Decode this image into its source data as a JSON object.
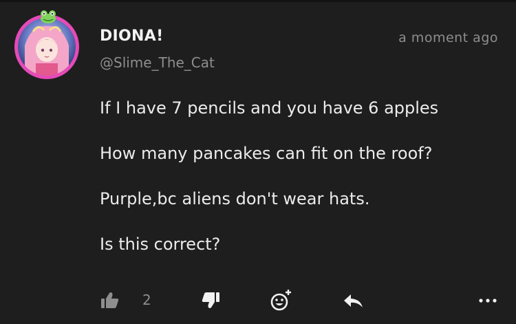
{
  "post": {
    "author_name": "DIONA!",
    "author_handle": "@Slime_The_Cat",
    "timestamp": "a moment ago",
    "lines": [
      "If I have 7 pencils and you have 6 apples",
      "How many pancakes can fit on the roof?",
      "Purple,bc aliens don't wear hats.",
      "Is this correct?"
    ]
  },
  "actions": {
    "like_icon": "thumbs-up-icon",
    "like_count": "2",
    "dislike_icon": "thumbs-down-icon",
    "react_icon": "add-reaction-icon",
    "reply_icon": "reply-arrow-icon",
    "more_icon": "more-options-icon"
  },
  "colors": {
    "background": "#1e1e1e",
    "text": "#ececec",
    "muted": "#8e8e8e",
    "avatar_ring": "#e64ab8"
  }
}
